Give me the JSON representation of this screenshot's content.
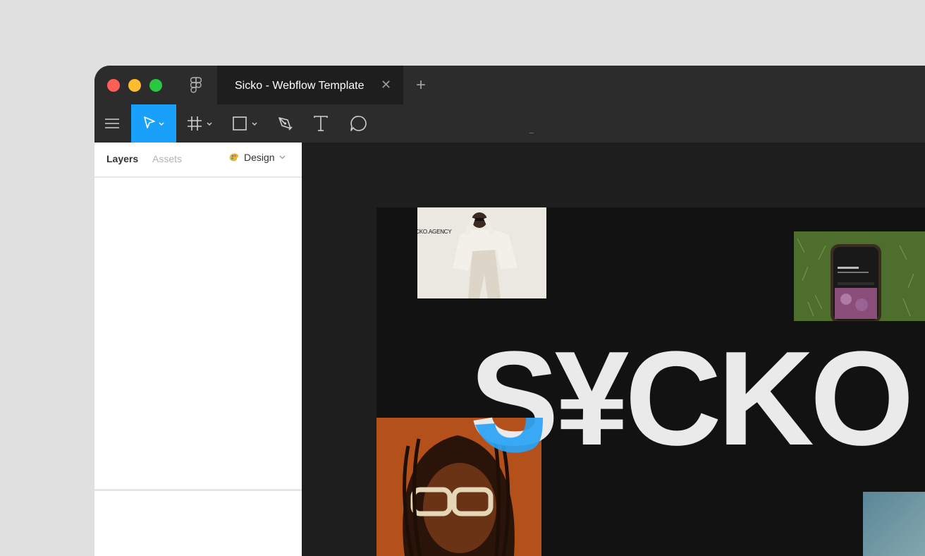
{
  "window": {
    "tab_title": "Sicko - Webflow Template",
    "close_glyph": "✕",
    "new_tab_glyph": "+"
  },
  "toolbar": {
    "tools": [
      "menu-icon",
      "move-tool-icon",
      "frame-tool-icon",
      "rectangle-tool-icon",
      "pen-tool-icon",
      "text-tool-icon",
      "comment-tool-icon"
    ],
    "active_tool": "move",
    "accent_color": "#18a0fb"
  },
  "sidebar": {
    "tabs": {
      "layers": "Layers",
      "assets": "Assets",
      "design": "Design"
    },
    "active_tab": "Layers"
  },
  "canvas": {
    "artboard": {
      "agency_label": "SICKO.AGENCY",
      "headline": "S¥CKO"
    }
  }
}
